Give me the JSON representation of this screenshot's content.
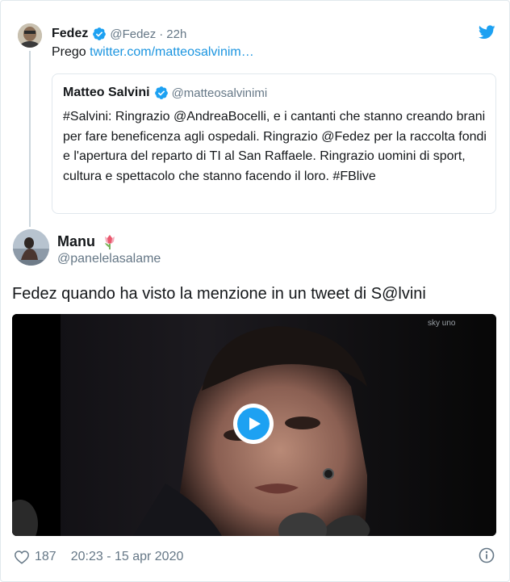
{
  "parent_tweet": {
    "name": "Fedez",
    "handle": "@Fedez",
    "separator": "·",
    "time": "22h",
    "body_prefix": "Prego ",
    "link": "twitter.com/matteosalvinim…"
  },
  "quoted_tweet": {
    "name": "Matteo Salvini",
    "handle": "@matteosalvinimi",
    "text": "#Salvini: Ringrazio @AndreaBocelli, e i cantanti che stanno creando brani per fare beneficenza agli ospedali. Ringrazio @Fedez per la raccolta fondi e l'apertura del reparto di TI al San Raffaele. Ringrazio uomini di sport, cultura e spettacolo che stanno facendo il loro. #FBlive"
  },
  "tweet": {
    "name": "Manu",
    "handle": "@panelelasalame",
    "text": "Fedez quando ha visto la menzione in un tweet di S@lvini",
    "likes": "187",
    "timestamp": "20:23 - 15 apr 2020"
  },
  "icons": {
    "verified": "verified-badge-icon",
    "twitter_logo": "twitter-bird-icon",
    "play": "play-icon",
    "like": "heart-icon",
    "info": "info-icon",
    "emoji": "tulip-emoji"
  },
  "colors": {
    "accent": "#1da1f2",
    "link": "#1b95e0",
    "muted": "#657786",
    "text": "#14171a",
    "border": "#e1e8ed"
  }
}
